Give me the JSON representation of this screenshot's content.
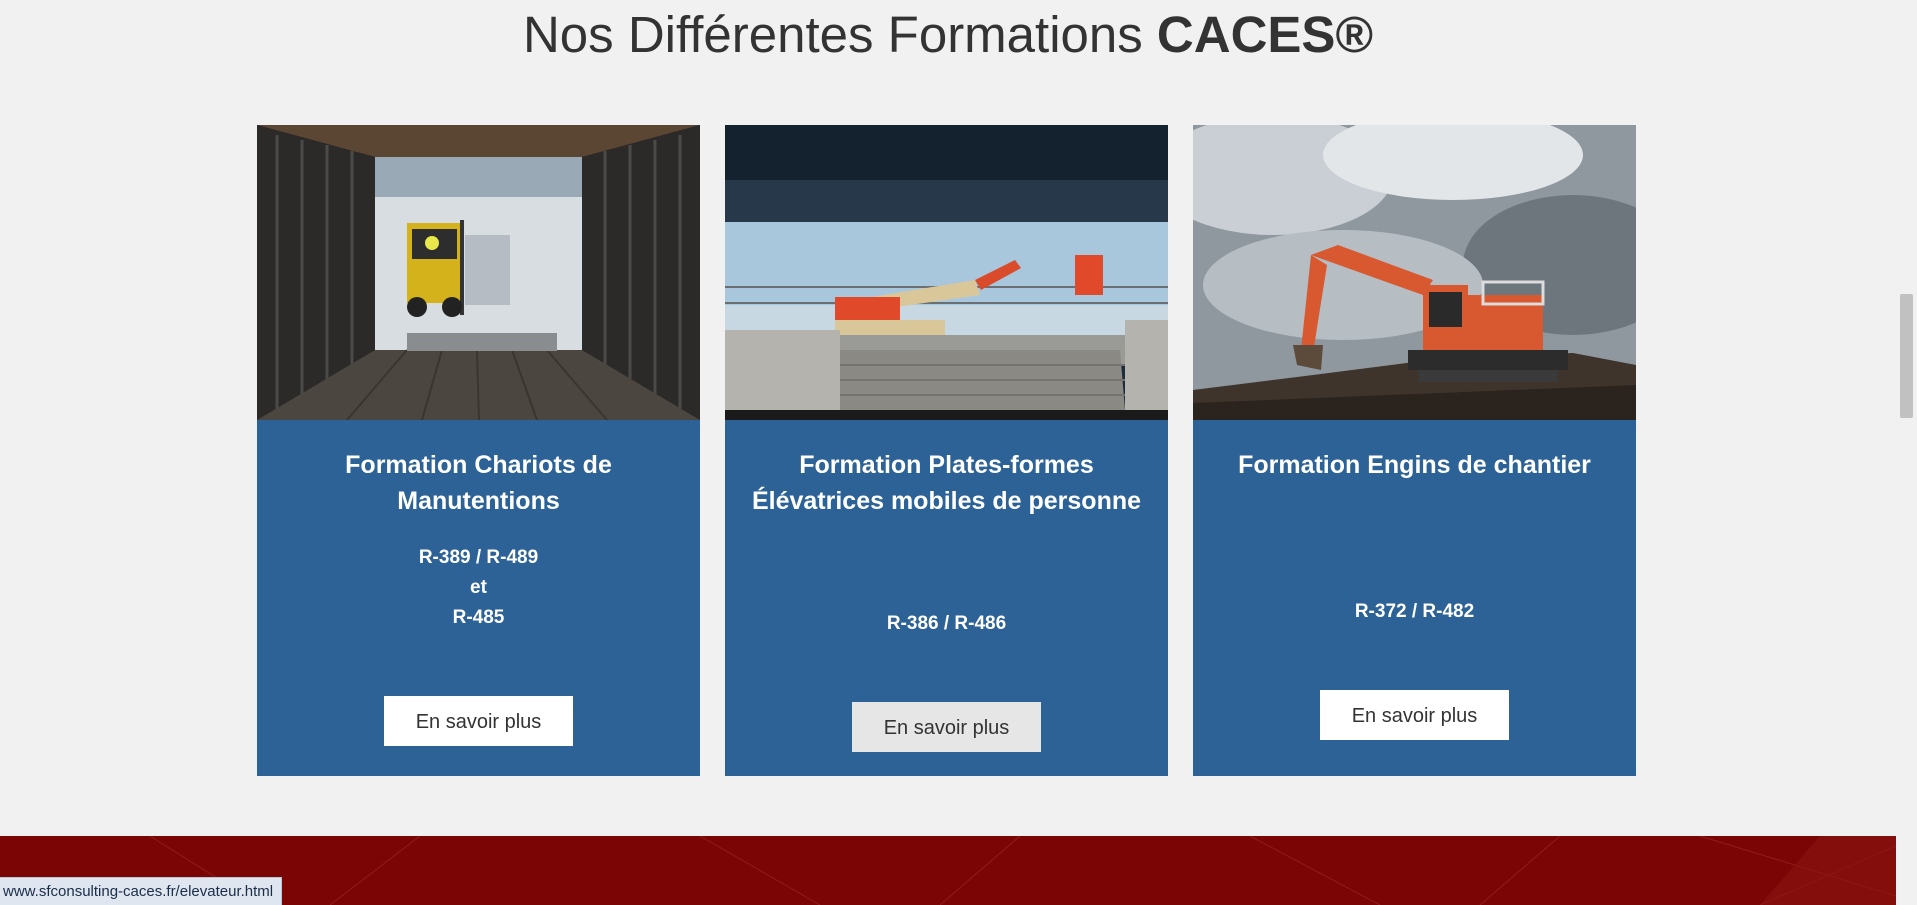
{
  "section": {
    "title_prefix": "Nos Différentes Formations ",
    "title_bold": "CACES®"
  },
  "cards": [
    {
      "title": "Formation Chariots de Manutentions",
      "codes_line1": "R-389 / R-489",
      "codes_line2": "et",
      "codes_line3": "R-485",
      "button": "En savoir plus",
      "image_icon": "forklift-photo"
    },
    {
      "title": "Formation Plates-formes Élévatrices mobiles de personne",
      "codes_line1": "R-386 / R-486",
      "button": "En savoir plus",
      "image_icon": "aerial-lift-photo"
    },
    {
      "title": "Formation Engins de chantier",
      "codes_line1": "R-372 / R-482",
      "button": "En savoir plus",
      "image_icon": "excavator-photo"
    }
  ],
  "status_bar": {
    "url": "www.sfconsulting-caces.fr/elevateur.html"
  },
  "colors": {
    "card_bg": "#2d6297",
    "page_bg": "#f1f1f1",
    "footer_bg": "#7a0504",
    "button_bg": "#ffffff"
  }
}
